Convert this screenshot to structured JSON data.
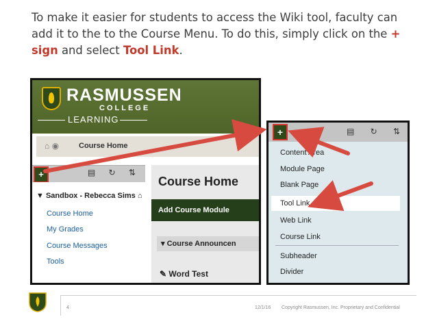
{
  "intro": {
    "text_before": "To make it easier for students to access the Wiki tool, faculty can add it to the to the Course Menu. To do this, simply click on the ",
    "plus_sign": "+ sign",
    "text_middle": " and select ",
    "tool_link": "Tool Link",
    "text_end": "."
  },
  "screenshot1": {
    "brand": "RASMUSSEN",
    "brand_sub": "COLLEGE",
    "brand_learning": "LEARNING",
    "breadcrumb": "Course Home",
    "add_button": "+",
    "toolbar_icons": "▤ ↻ ⇅",
    "course_title": "Sandbox - Rebecca Sims",
    "menu_items": [
      "Course Home",
      "My Grades",
      "Course Messages",
      "Tools"
    ],
    "page_heading": "Course Home",
    "add_module": "Add Course Module",
    "announcement": "Course Announcen",
    "word_test": "Word Test"
  },
  "screenshot2": {
    "add_button": "+",
    "toolbar_icons": "▤ ↻ ⇅",
    "items": [
      "Content Area",
      "Module Page",
      "Blank Page",
      "Tool Link",
      "Web Link",
      "Course Link",
      "Subheader",
      "Divider"
    ]
  },
  "footer": {
    "slide_number": "4",
    "date": "12/1/16",
    "copyright": "Copyright Rasmussen, Inc. Proprietary and Confidential"
  },
  "colors": {
    "highlight": "#c0392b",
    "arrow": "#d64a3f",
    "header_green": "#556b2f",
    "link_blue": "#1a5e9a"
  }
}
